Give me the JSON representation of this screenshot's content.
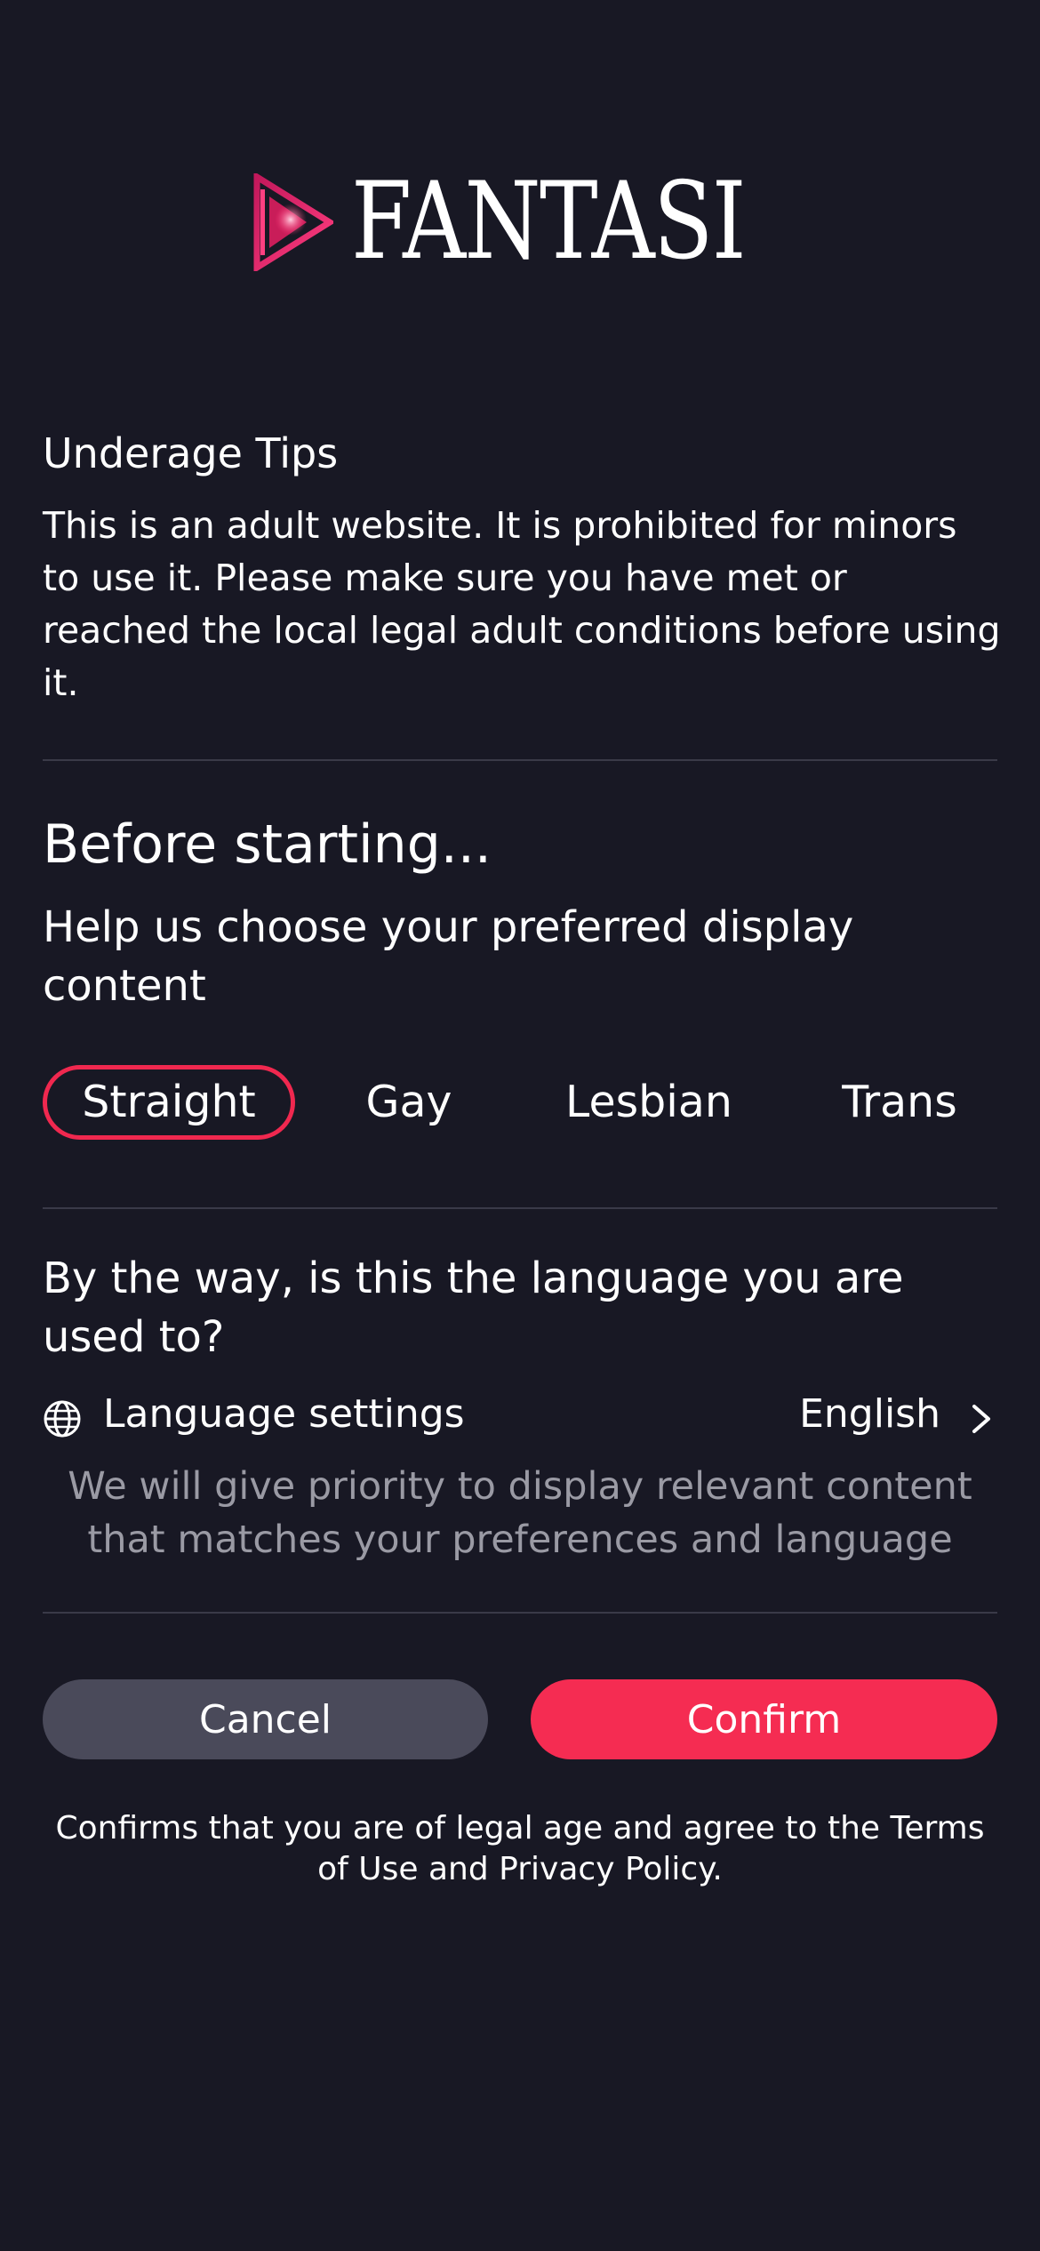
{
  "brand": {
    "name": "FANTASI",
    "accent_color": "#f0284f",
    "logo_icon": "play-logo-icon"
  },
  "underage": {
    "title": "Underage Tips",
    "body": "This is an adult website. It is prohibited for minors to use it. Please make sure you have met or reached the local legal adult conditions before using it."
  },
  "preferences": {
    "title": "Before starting...",
    "subtitle": "Help us choose your preferred display content",
    "options": [
      {
        "label": "Straight",
        "selected": true
      },
      {
        "label": "Gay",
        "selected": false
      },
      {
        "label": "Lesbian",
        "selected": false
      },
      {
        "label": "Trans",
        "selected": false
      }
    ]
  },
  "language": {
    "question": "By the way, is this the language you are used to?",
    "settings_label": "Language settings",
    "settings_icon": "globe-icon",
    "current_value": "English",
    "arrow_icon": "chevron-right-icon",
    "note": "We will give priority to display relevant content that matches your preferences and language"
  },
  "actions": {
    "cancel_label": "Cancel",
    "confirm_label": "Confirm"
  },
  "legal": {
    "text": "Confirms that you are of legal age and agree to the Terms of Use and Privacy Policy."
  }
}
